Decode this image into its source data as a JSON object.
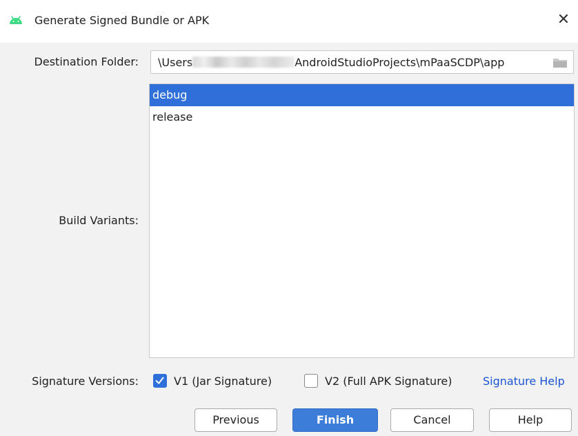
{
  "window": {
    "title": "Generate Signed Bundle or APK",
    "app_icon": "android-icon",
    "close_symbol": "✕"
  },
  "destination": {
    "label": "Destination Folder:",
    "value_prefix": "\\Users",
    "value_suffix": "AndroidStudioProjects\\mPaaSCDP\\app",
    "browse_icon": "folder-icon"
  },
  "build_variants": {
    "label": "Build Variants:",
    "items": [
      {
        "label": "debug",
        "selected": true
      },
      {
        "label": "release",
        "selected": false
      }
    ]
  },
  "signature": {
    "label": "Signature Versions:",
    "v1": {
      "label": "V1 (Jar Signature)",
      "checked": true
    },
    "v2": {
      "label": "V2 (Full APK Signature)",
      "checked": false
    },
    "help_link": "Signature Help"
  },
  "buttons": {
    "previous": "Previous",
    "finish": "Finish",
    "cancel": "Cancel",
    "help": "Help"
  },
  "colors": {
    "accent": "#2e6fd9",
    "link": "#1a55d6",
    "android_green": "#3ddc84",
    "folder": "#b9b9b9"
  }
}
